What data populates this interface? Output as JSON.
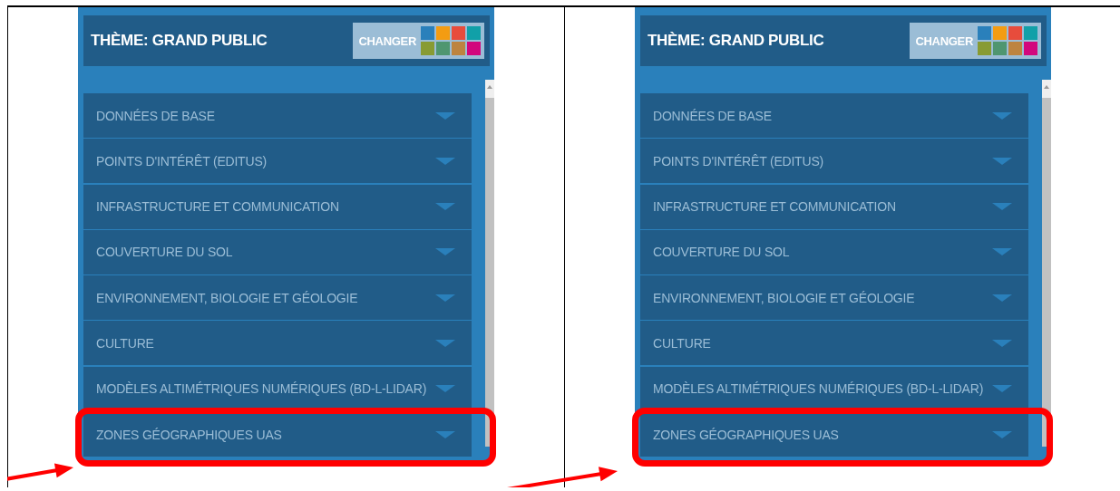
{
  "panels": [
    {
      "theme_title": "THÈME: GRAND PUBLIC",
      "change_button": {
        "label": "CHANGER",
        "swatches": [
          {
            "color": "#2a80bb"
          },
          {
            "color": "#f39c12"
          },
          {
            "color": "#e74c3c"
          },
          {
            "color": "#11a0a8"
          },
          {
            "color": "#889b33"
          },
          {
            "color": "#4f9670"
          },
          {
            "color": "#bd8440"
          },
          {
            "color": "#d2077d"
          }
        ]
      },
      "categories": [
        {
          "label": "DONNÉES DE BASE",
          "expanded": false,
          "highlighted": false
        },
        {
          "label": "POINTS D'INTÉRÊT (EDITUS)",
          "expanded": false,
          "highlighted": false
        },
        {
          "label": "INFRASTRUCTURE ET COMMUNICATION",
          "expanded": false,
          "highlighted": false
        },
        {
          "label": "COUVERTURE DU SOL",
          "expanded": false,
          "highlighted": false
        },
        {
          "label": "ENVIRONNEMENT, BIOLOGIE ET GÉOLOGIE",
          "expanded": false,
          "highlighted": false
        },
        {
          "label": "CULTURE",
          "expanded": false,
          "highlighted": false
        },
        {
          "label": "MODÈLES ALTIMÉTRIQUES NUMÉRIQUES (BD-L-LIDAR)",
          "expanded": false,
          "highlighted": false
        },
        {
          "label": "ZONES GÉOGRAPHIQUES UAS",
          "expanded": false,
          "highlighted": true
        }
      ]
    },
    {
      "theme_title": "THÈME: GRAND PUBLIC",
      "change_button": {
        "label": "CHANGER",
        "swatches": [
          {
            "color": "#2a80bb"
          },
          {
            "color": "#f39c12"
          },
          {
            "color": "#e74c3c"
          },
          {
            "color": "#11a0a8"
          },
          {
            "color": "#889b33"
          },
          {
            "color": "#4f9670"
          },
          {
            "color": "#bd8440"
          },
          {
            "color": "#d2077d"
          }
        ]
      },
      "categories": [
        {
          "label": "DONNÉES DE BASE",
          "expanded": false,
          "highlighted": false
        },
        {
          "label": "POINTS D'INTÉRÊT (EDITUS)",
          "expanded": false,
          "highlighted": false
        },
        {
          "label": "INFRASTRUCTURE ET COMMUNICATION",
          "expanded": false,
          "highlighted": false
        },
        {
          "label": "COUVERTURE DU SOL",
          "expanded": false,
          "highlighted": false
        },
        {
          "label": "ENVIRONNEMENT, BIOLOGIE ET GÉOLOGIE",
          "expanded": false,
          "highlighted": false
        },
        {
          "label": "CULTURE",
          "expanded": false,
          "highlighted": false
        },
        {
          "label": "MODÈLES ALTIMÉTRIQUES NUMÉRIQUES (BD-L-LIDAR)",
          "expanded": false,
          "highlighted": false
        },
        {
          "label": "ZONES GÉOGRAPHIQUES UAS",
          "expanded": false,
          "highlighted": true
        }
      ]
    }
  ]
}
